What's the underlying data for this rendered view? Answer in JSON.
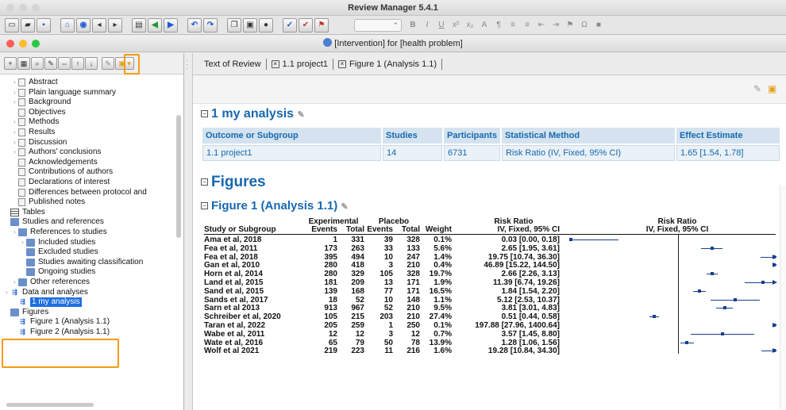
{
  "app": {
    "title": "Review Manager 5.4.1",
    "doc_title": "[Intervention] for [health problem]"
  },
  "colors": {
    "heading_blue": "#1668b0",
    "highlight_orange": "#f39c12",
    "selection_blue": "#1f6fe0",
    "ci_blue": "#1a3e8c"
  },
  "toolbar": {
    "icons": [
      "new-doc-icon",
      "open-folder-icon",
      "save-icon",
      "home-icon",
      "properties-icon",
      "back-icon",
      "forward-icon",
      "print-icon",
      "prev-arrow-icon",
      "next-arrow-icon",
      "undo-icon",
      "redo-icon",
      "copy-icon",
      "paste-icon",
      "delete-icon",
      "spellcheck-icon",
      "check-icon",
      "bookmark-icon"
    ],
    "format_buttons": [
      "B",
      "I",
      "U",
      "x²",
      "x₂",
      "A",
      "¶",
      "≡",
      "≡",
      "⇤",
      "⇥",
      "⚑",
      "Ω",
      "■"
    ]
  },
  "left_toolbar": {
    "icons": [
      "add-icon",
      "table-icon",
      "search-doc-icon",
      "edit-doc-icon",
      "link-icon",
      "move-up-icon",
      "move-down-icon",
      "pencil-icon",
      "note-icon"
    ]
  },
  "tree": {
    "items": [
      {
        "label": "Abstract",
        "indent": 1,
        "arrow": true,
        "icon": "doc"
      },
      {
        "label": "Plain language summary",
        "indent": 1,
        "arrow": true,
        "icon": "doc"
      },
      {
        "label": "Background",
        "indent": 1,
        "arrow": true,
        "icon": "doc"
      },
      {
        "label": "Objectives",
        "indent": 1,
        "arrow": false,
        "icon": "doc"
      },
      {
        "label": "Methods",
        "indent": 1,
        "arrow": true,
        "icon": "doc"
      },
      {
        "label": "Results",
        "indent": 1,
        "arrow": true,
        "icon": "doc"
      },
      {
        "label": "Discussion",
        "indent": 1,
        "arrow": true,
        "icon": "doc"
      },
      {
        "label": "Authors' conclusions",
        "indent": 1,
        "arrow": true,
        "icon": "doc"
      },
      {
        "label": "Acknowledgements",
        "indent": 1,
        "arrow": false,
        "icon": "doc"
      },
      {
        "label": "Contributions of authors",
        "indent": 1,
        "arrow": false,
        "icon": "doc"
      },
      {
        "label": "Declarations of interest",
        "indent": 1,
        "arrow": false,
        "icon": "doc"
      },
      {
        "label": "Differences between protocol and",
        "indent": 1,
        "arrow": false,
        "icon": "doc"
      },
      {
        "label": "Published notes",
        "indent": 1,
        "arrow": false,
        "icon": "doc"
      },
      {
        "label": "Tables",
        "indent": 0,
        "arrow": false,
        "icon": "table"
      },
      {
        "label": "Studies and references",
        "indent": 0,
        "arrow": false,
        "icon": "folder"
      },
      {
        "label": "References to studies",
        "indent": 1,
        "arrow": true,
        "icon": "folder"
      },
      {
        "label": "Included studies",
        "indent": 2,
        "arrow": true,
        "icon": "folder"
      },
      {
        "label": "Excluded studies",
        "indent": 2,
        "arrow": false,
        "icon": "folder"
      },
      {
        "label": "Studies awaiting classification",
        "indent": 2,
        "arrow": false,
        "icon": "folder"
      },
      {
        "label": "Ongoing studies",
        "indent": 2,
        "arrow": false,
        "icon": "folder"
      },
      {
        "label": "Other references",
        "indent": 1,
        "arrow": true,
        "icon": "folder"
      },
      {
        "label": "Data and analyses",
        "indent": 0,
        "arrow": true,
        "icon": "fig"
      },
      {
        "label": "1 my analysis",
        "indent": 1,
        "arrow": false,
        "icon": "fig",
        "selected": true
      },
      {
        "label": "Figures",
        "indent": 0,
        "arrow": false,
        "icon": "folder"
      },
      {
        "label": "Figure 1 (Analysis 1.1)",
        "indent": 1,
        "arrow": false,
        "icon": "fig"
      },
      {
        "label": "Figure 2 (Analysis 1.1)",
        "indent": 1,
        "arrow": false,
        "icon": "fig"
      }
    ]
  },
  "tabs": [
    {
      "label": "Text of Review",
      "closable": false
    },
    {
      "label": "1.1 project1",
      "closable": true
    },
    {
      "label": "Figure 1 (Analysis 1.1)",
      "closable": true
    }
  ],
  "analysis": {
    "heading": "1 my analysis",
    "headers": [
      "Outcome or Subgroup",
      "Studies",
      "Participants",
      "Statistical Method",
      "Effect Estimate"
    ],
    "row": [
      "1.1 project1",
      "14",
      "6731",
      "Risk Ratio (IV, Fixed, 95% CI)",
      "1.65 [1.54, 1.78]"
    ]
  },
  "figures": {
    "heading": "Figures",
    "figure1_heading": "Figure 1 (Analysis 1.1)"
  },
  "forest": {
    "group_headers": {
      "experimental": "Experimental",
      "placebo": "Placebo",
      "rr": "Risk Ratio",
      "rr_plot": "Risk Ratio"
    },
    "col_headers": {
      "study": "Study or Subgroup",
      "events": "Events",
      "total": "Total",
      "events2": "Events",
      "total2": "Total",
      "weight": "Weight",
      "ci": "IV, Fixed, 95% CI",
      "ci_plot": "IV, Fixed, 95% CI"
    },
    "studies": [
      {
        "name": "Ama et al, 2018",
        "e1": "1",
        "t1": "331",
        "e2": "39",
        "t2": "328",
        "w": "0.1%",
        "rr": "0.03 [0.00, 0.18]",
        "est": 0.03,
        "lo": 0.002,
        "hi": 0.18
      },
      {
        "name": "Fea et al, 2011",
        "e1": "173",
        "t1": "263",
        "e2": "33",
        "t2": "133",
        "w": "5.6%",
        "rr": "2.65 [1.95, 3.61]",
        "est": 2.65,
        "lo": 1.95,
        "hi": 3.61
      },
      {
        "name": "Fea et al, 2018",
        "e1": "395",
        "t1": "494",
        "e2": "10",
        "t2": "247",
        "w": "1.4%",
        "rr": "19.75 [10.74, 36.30]",
        "est": 19.75,
        "lo": 10.74,
        "hi": 36.3
      },
      {
        "name": "Gan et al, 2010",
        "e1": "280",
        "t1": "418",
        "e2": "3",
        "t2": "210",
        "w": "0.4%",
        "rr": "46.89 [15.22, 144.50]",
        "est": 46.89,
        "lo": 15.22,
        "hi": 144.5
      },
      {
        "name": "Horn et al, 2014",
        "e1": "280",
        "t1": "329",
        "e2": "105",
        "t2": "328",
        "w": "19.7%",
        "rr": "2.66 [2.26, 3.13]",
        "est": 2.66,
        "lo": 2.26,
        "hi": 3.13
      },
      {
        "name": "Land et al, 2015",
        "e1": "181",
        "t1": "209",
        "e2": "13",
        "t2": "171",
        "w": "1.9%",
        "rr": "11.39 [6.74, 19.26]",
        "est": 11.39,
        "lo": 6.74,
        "hi": 19.26
      },
      {
        "name": "Sand et al, 2015",
        "e1": "139",
        "t1": "168",
        "e2": "77",
        "t2": "171",
        "w": "16.5%",
        "rr": "1.84 [1.54, 2.20]",
        "est": 1.84,
        "lo": 1.54,
        "hi": 2.2
      },
      {
        "name": "Sands et al, 2017",
        "e1": "18",
        "t1": "52",
        "e2": "10",
        "t2": "148",
        "w": "1.1%",
        "rr": "5.12 [2.53, 10.37]",
        "est": 5.12,
        "lo": 2.53,
        "hi": 10.37
      },
      {
        "name": "Sarn et al 2013",
        "e1": "913",
        "t1": "967",
        "e2": "52",
        "t2": "210",
        "w": "9.5%",
        "rr": "3.81 [3.01, 4.83]",
        "est": 3.81,
        "lo": 3.01,
        "hi": 4.83
      },
      {
        "name": "Schreiber et al, 2020",
        "e1": "105",
        "t1": "215",
        "e2": "203",
        "t2": "210",
        "w": "27.4%",
        "rr": "0.51 [0.44, 0.58]",
        "est": 0.51,
        "lo": 0.44,
        "hi": 0.58
      },
      {
        "name": "Taran et al, 2022",
        "e1": "205",
        "t1": "259",
        "e2": "1",
        "t2": "250",
        "w": "0.1%",
        "rr": "197.88 [27.96, 1400.64]",
        "est": 197.88,
        "lo": 27.96,
        "hi": 1400.64
      },
      {
        "name": "Wabe et al, 2011",
        "e1": "12",
        "t1": "12",
        "e2": "3",
        "t2": "12",
        "w": "0.7%",
        "rr": "3.57 [1.45, 8.80]",
        "est": 3.57,
        "lo": 1.45,
        "hi": 8.8
      },
      {
        "name": "Wate et al, 2016",
        "e1": "65",
        "t1": "79",
        "e2": "50",
        "t2": "78",
        "w": "13.9%",
        "rr": "1.28 [1.06, 1.56]",
        "est": 1.28,
        "lo": 1.06,
        "hi": 1.56
      },
      {
        "name": "Wolf et al 2021",
        "e1": "219",
        "t1": "223",
        "e2": "11",
        "t2": "216",
        "w": "1.6%",
        "rr": "19.28 [10.84, 34.30]",
        "est": 19.28,
        "lo": 10.84,
        "hi": 34.3
      }
    ]
  }
}
